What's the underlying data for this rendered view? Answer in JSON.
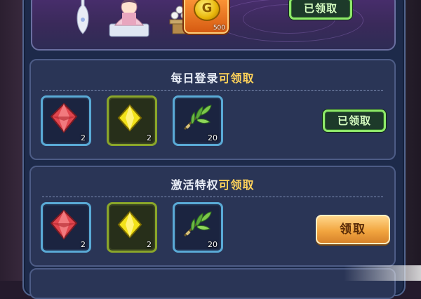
{
  "top_section": {
    "coin_count": "500",
    "claim_button_label": "已领取"
  },
  "sections": [
    {
      "title_prefix": "每日登录",
      "title_suffix": "可领取",
      "items": [
        {
          "icon": "red-gem-icon",
          "qty": "2"
        },
        {
          "icon": "yellow-gem-icon",
          "qty": "2"
        },
        {
          "icon": "herb-bundle-icon",
          "qty": "20"
        }
      ],
      "button_label": "已领取",
      "button_state": "claimed"
    },
    {
      "title_prefix": "激活特权",
      "title_suffix": "可领取",
      "items": [
        {
          "icon": "red-gem-icon",
          "qty": "2"
        },
        {
          "icon": "yellow-gem-icon",
          "qty": "2"
        },
        {
          "icon": "herb-bundle-icon",
          "qty": "20"
        }
      ],
      "button_label": "领取",
      "button_state": "claimable"
    }
  ],
  "colors": {
    "panel_bg": "#2a3556",
    "highlight_text": "#ffd25a",
    "claimed_border": "#8ee86a",
    "claim_button": "#f2a640"
  }
}
